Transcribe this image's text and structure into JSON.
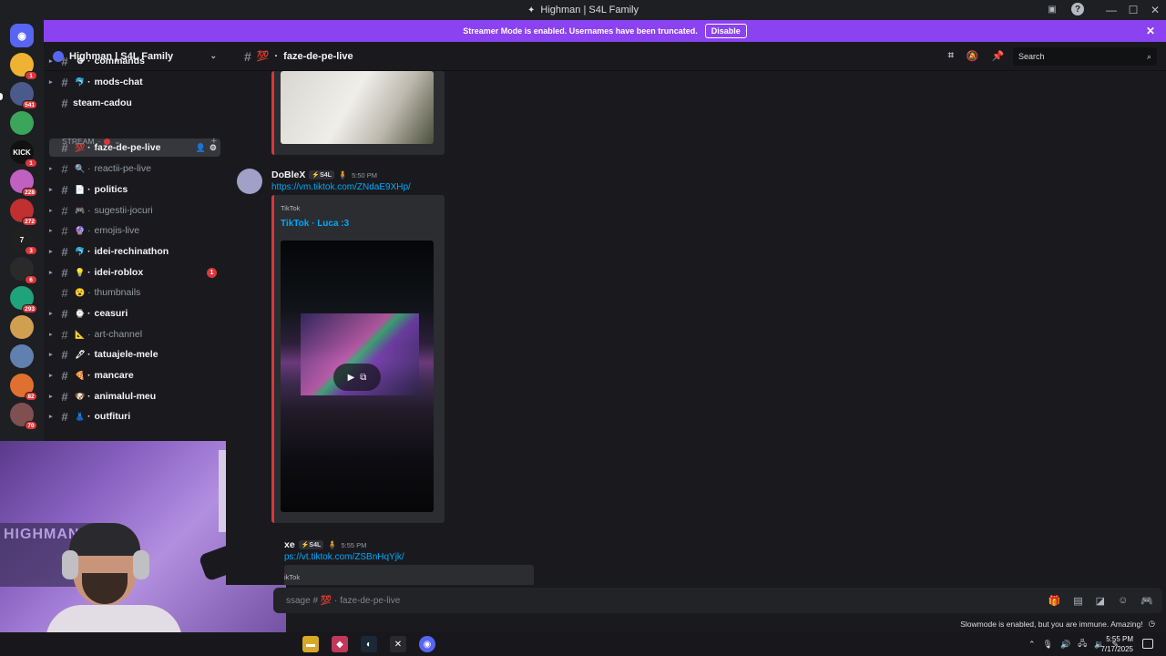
{
  "window": {
    "title": "Highman | S4L Family"
  },
  "banner": {
    "text": "Streamer Mode is enabled. Usernames have been truncated.",
    "disable_label": "Disable"
  },
  "guilds": [
    {
      "badge": "1",
      "color": "#f0b232",
      "label": "",
      "icon": "bear-server-icon"
    },
    {
      "badge": "541",
      "color": "#4a5a8a",
      "label": "",
      "icon": "sword-server-icon"
    },
    {
      "badge": "",
      "color": "#3ba55c",
      "label": "",
      "icon": "frog-server-icon"
    },
    {
      "badge": "1",
      "color": "#111111",
      "label": "KICK",
      "icon": "kick-server-icon"
    },
    {
      "badge": "228",
      "color": "#c060c0",
      "label": "",
      "icon": "pink-server-icon"
    },
    {
      "badge": "272",
      "color": "#c03030",
      "label": "",
      "icon": "red-server-icon"
    },
    {
      "badge": "3",
      "color": "#202020",
      "label": "7",
      "icon": "seven-server-icon"
    },
    {
      "badge": "6",
      "color": "#2a2a2a",
      "label": "",
      "icon": "skull-server-icon"
    },
    {
      "badge": "293",
      "color": "#1fa37a",
      "label": "",
      "icon": "teal-server-icon"
    },
    {
      "badge": "",
      "color": "#d0a050",
      "label": "",
      "icon": "doge-server-icon"
    },
    {
      "badge": "",
      "color": "#6080b0",
      "label": "",
      "icon": "character-server-icon"
    },
    {
      "badge": "82",
      "color": "#e07030",
      "label": "",
      "icon": "game-server-icon"
    },
    {
      "badge": "70",
      "color": "#805050",
      "label": "",
      "icon": "avatar-server-icon"
    }
  ],
  "server": {
    "name": "Highman | S4L Family"
  },
  "channels": [
    {
      "name": "commands",
      "emoji": "⚙",
      "unread": true,
      "arrow": true
    },
    {
      "name": "mods-chat",
      "emoji": "🐬",
      "unread": true,
      "arrow": true
    },
    {
      "name": "steam-cadou",
      "emoji": "",
      "unread": true,
      "arrow": false
    },
    {
      "name": "faze-de-pe-live",
      "emoji": "💯",
      "unread": true,
      "arrow": false,
      "active": true
    },
    {
      "name": "reactii-pe-live",
      "emoji": "🔍",
      "unread": false,
      "arrow": true
    },
    {
      "name": "politics",
      "emoji": "📄",
      "unread": true,
      "arrow": true
    },
    {
      "name": "sugestii-jocuri",
      "emoji": "🎮",
      "unread": false,
      "arrow": true
    },
    {
      "name": "emojis-live",
      "emoji": "🔮",
      "unread": false,
      "arrow": true
    },
    {
      "name": "idei-rechinathon",
      "emoji": "🐬",
      "unread": true,
      "arrow": true
    },
    {
      "name": "idei-roblox",
      "emoji": "💡",
      "unread": true,
      "arrow": true,
      "mentions": "1"
    },
    {
      "name": "thumbnails",
      "emoji": "😮",
      "unread": false,
      "arrow": false
    },
    {
      "name": "ceasuri",
      "emoji": "⌚",
      "unread": true,
      "arrow": true
    },
    {
      "name": "art-channel",
      "emoji": "📐",
      "unread": false,
      "arrow": true
    },
    {
      "name": "tatuajele-mele",
      "emoji": "🖋",
      "unread": true,
      "arrow": true
    },
    {
      "name": "mancare",
      "emoji": "🍕",
      "unread": true,
      "arrow": true
    },
    {
      "name": "animalul-meu",
      "emoji": "🐶",
      "unread": true,
      "arrow": true
    },
    {
      "name": "outfituri",
      "emoji": "👗",
      "unread": true,
      "arrow": true
    }
  ],
  "category": {
    "name": "STREAM",
    "plus": "+"
  },
  "chat_header": {
    "channel": "faze-de-pe-live",
    "emoji": "💯",
    "search_placeholder": "Search"
  },
  "messages": [
    {
      "author": "DoBleX",
      "tag": "S4L",
      "time": "5:50 PM",
      "link": "https://vm.tiktok.com/ZNdaE9XHp/",
      "embed_provider": "TikTok",
      "embed_title": "TikTok · Luca :3"
    },
    {
      "author": "xe",
      "tag": "S4L",
      "time": "5:55 PM",
      "link": "ps://vt.tiktok.com/ZSBnHqYjk/",
      "embed_provider": "ikTok"
    }
  ],
  "composer": {
    "placeholder": "ssage # 💯 · faze-de-pe-live"
  },
  "slowmode": {
    "text": "Slowmode is enabled, but you are immune. Amazing!"
  },
  "webcam": {
    "poster_text": "HIGHMAN"
  },
  "taskbar": {
    "time": "5:55 PM",
    "date": "7/17/2025"
  },
  "colors": {
    "accent": "#8b42f0",
    "link": "#00a8fc",
    "danger": "#da373c",
    "bg": "#1a1a1e"
  }
}
